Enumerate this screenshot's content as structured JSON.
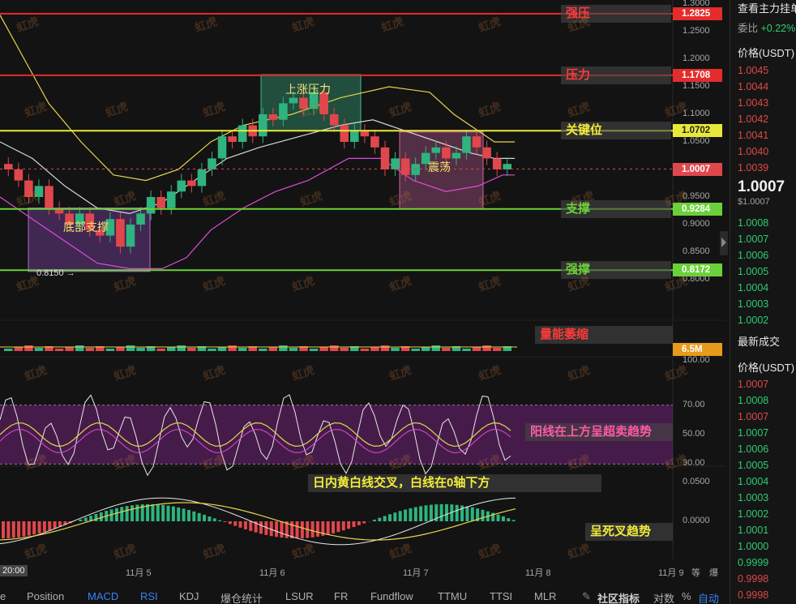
{
  "chart_data": {
    "type": "candlestick",
    "symbol_quote": "USDT",
    "price_axis": {
      "ticks": [
        "1.3000",
        "1.2500",
        "1.2000",
        "1.1500",
        "1.1000",
        "1.0500",
        "1.0000",
        "0.9500",
        "0.9000",
        "0.8500",
        "0.8000"
      ],
      "range": [
        0.78,
        1.3
      ]
    },
    "levels": [
      {
        "name": "强压",
        "value": "1.2825",
        "color": "#e52b2b"
      },
      {
        "name": "压力",
        "value": "1.1708",
        "color": "#e52b2b"
      },
      {
        "name": "关键位",
        "value": "1.0702",
        "color": "#e8e83a"
      },
      {
        "name": "支撑",
        "value": "0.9284",
        "color": "#6bd13a"
      },
      {
        "name": "强撑",
        "value": "0.8172",
        "color": "#6bd13a"
      }
    ],
    "current_price": "1.0007",
    "low_marker": "0.8150",
    "zones": [
      {
        "label": "底部支撑",
        "color": "#b36bd6"
      },
      {
        "label": "上涨压力",
        "color": "#3fbf8f"
      },
      {
        "label": "震荡",
        "color": "#d65fa0"
      }
    ],
    "volume": {
      "label": "量能萎缩",
      "value": "6.5M"
    },
    "rsi": {
      "ticks": [
        "100.00",
        "70.00",
        "50.00",
        "30.00"
      ],
      "annotation": "阳线在上方呈超卖趋势"
    },
    "macd": {
      "ticks": [
        "0.0500",
        "0.0000"
      ],
      "annotation_top": "日内黄白线交叉，白线在0轴下方",
      "annotation_bottom": "呈死叉趋势"
    },
    "x_axis": {
      "labels": [
        "20:00",
        "11月 5",
        "11月 6",
        "11月 7",
        "11月 8",
        "11月 9"
      ]
    },
    "candles": [
      1.0,
      0.98,
      0.95,
      0.97,
      0.93,
      0.92,
      0.9,
      0.92,
      0.89,
      0.88,
      0.91,
      0.86,
      0.9,
      0.92,
      0.95,
      0.93,
      0.96,
      0.98,
      0.97,
      1.0,
      1.02,
      1.06,
      1.05,
      1.08,
      1.06,
      1.1,
      1.09,
      1.12,
      1.13,
      1.11,
      1.14,
      1.1,
      1.08,
      1.05,
      1.07,
      1.06,
      1.04,
      1.0,
      1.02,
      0.99,
      1.01,
      1.03,
      1.04,
      1.02,
      1.03,
      1.06,
      1.04,
      1.02,
      1.0,
      1.01
    ]
  },
  "watermark": "虹虎",
  "right_panel": {
    "header": "查看主力挂单",
    "commission_label": "委比",
    "commission_value": "+0.22%",
    "price_header": "价格(USDT)",
    "asks": [
      "1.0045",
      "1.0044",
      "1.0043",
      "1.0042",
      "1.0041",
      "1.0040",
      "1.0039"
    ],
    "last_price": "1.0007",
    "last_price_usd": "$1.0007",
    "bids": [
      "1.0008",
      "1.0007",
      "1.0006",
      "1.0005",
      "1.0004",
      "1.0003",
      "1.0002"
    ],
    "trades_header": "最新成交",
    "trades_price_header": "价格(USDT)",
    "trades": [
      {
        "p": "1.0007",
        "c": "red"
      },
      {
        "p": "1.0008",
        "c": "green"
      },
      {
        "p": "1.0007",
        "c": "red"
      },
      {
        "p": "1.0007",
        "c": "green"
      },
      {
        "p": "1.0006",
        "c": "green"
      },
      {
        "p": "1.0005",
        "c": "green"
      },
      {
        "p": "1.0004",
        "c": "green"
      },
      {
        "p": "1.0003",
        "c": "green"
      },
      {
        "p": "1.0002",
        "c": "green"
      },
      {
        "p": "1.0001",
        "c": "green"
      },
      {
        "p": "1.0000",
        "c": "green"
      },
      {
        "p": "0.9999",
        "c": "green"
      },
      {
        "p": "0.9998",
        "c": "red"
      },
      {
        "p": "0.9998",
        "c": "red"
      }
    ]
  },
  "bottom_tabs": [
    "e",
    "Position",
    "MACD",
    "RSI",
    "KDJ",
    "爆仓统计",
    "LSUR",
    "FR",
    "Fundflow",
    "TTMU",
    "TTSI",
    "MLR"
  ],
  "bottom_right": {
    "community": "社区指标",
    "log": "对数",
    "percent": "%",
    "auto": "自动"
  },
  "axis_extra": {
    "equal": "等",
    "burst": "爆"
  }
}
